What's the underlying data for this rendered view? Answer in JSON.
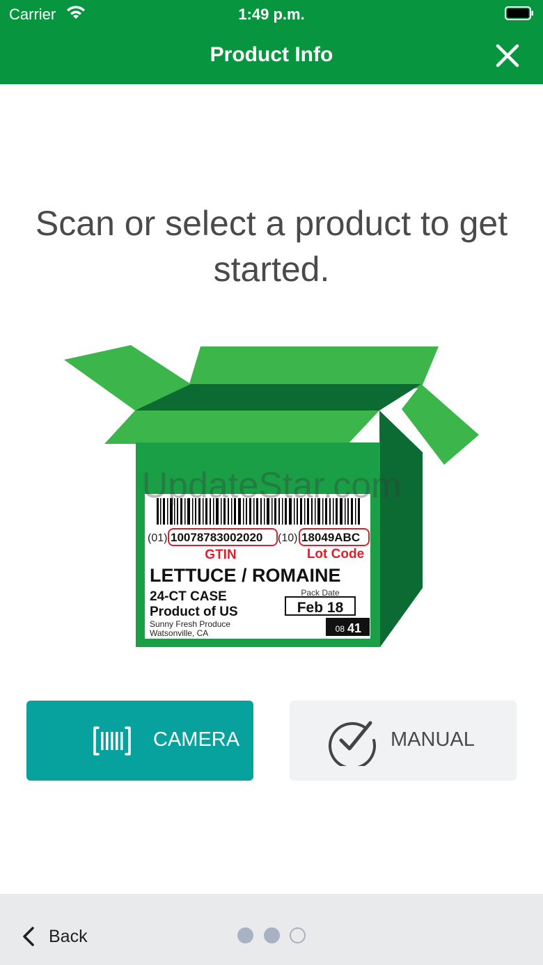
{
  "status_bar": {
    "carrier": "Carrier",
    "time": "1:49 p.m."
  },
  "nav": {
    "title": "Product Info"
  },
  "headline": "Scan or select a product to get started.",
  "watermark": "UpdateStar.com",
  "label": {
    "gtin_prefix": "(01)",
    "gtin": "10078783002020",
    "lot_prefix": "(10)",
    "lot": "18049ABC",
    "gtin_caption": "GTIN",
    "lot_caption": "Lot Code",
    "product_name": "LETTUCE / ROMAINE",
    "case": "24-CT CASE",
    "origin": "Product of US",
    "company": "Sunny Fresh Produce",
    "location": "Watsonville, CA",
    "pack_date_caption": "Pack Date",
    "pack_date": "Feb 18",
    "voice_pick_small": "08",
    "voice_pick_large": "41"
  },
  "buttons": {
    "camera": "CAMERA",
    "manual": "MANUAL"
  },
  "footer": {
    "back": "Back",
    "page_total": 3,
    "page_current": 2
  },
  "colors": {
    "brand_green": "#07953f",
    "box_green": "#1a9e46",
    "teal": "#08a29e",
    "label_red": "#e01e2b"
  },
  "icons": {
    "wifi": "wifi-icon",
    "battery": "battery-icon",
    "close": "close-icon",
    "barcode": "barcode-scan-icon",
    "check": "check-circle-icon",
    "back": "chevron-left-icon"
  }
}
